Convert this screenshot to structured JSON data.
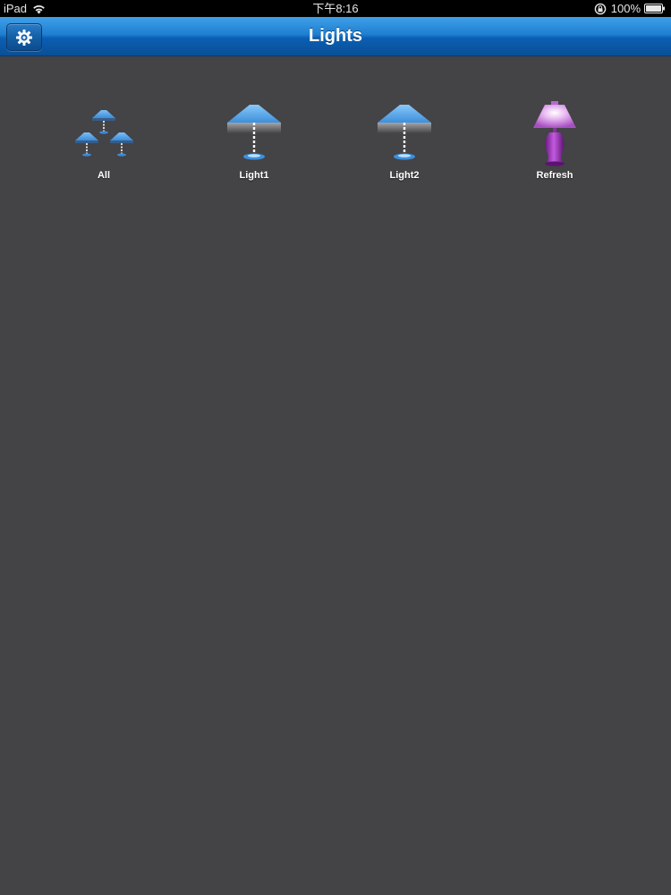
{
  "status_bar": {
    "device": "iPad",
    "time": "下午8:16",
    "battery": "100%",
    "icons": [
      "wifi-icon",
      "orientation-lock-icon",
      "battery-icon"
    ]
  },
  "nav_bar": {
    "title": "Lights",
    "settings_icon": "gear-icon",
    "accent_color": "#1f7fd1"
  },
  "tiles": [
    {
      "label": "All",
      "icon": "multi-lamp-icon",
      "color": "#4a9fe8"
    },
    {
      "label": "Light1",
      "icon": "blue-lamp-icon",
      "color": "#4a9fe8"
    },
    {
      "label": "Light2",
      "icon": "blue-lamp-icon",
      "color": "#4a9fe8"
    },
    {
      "label": "Refresh",
      "icon": "purple-lamp-icon",
      "color": "#9b3fb0"
    }
  ],
  "background_color": "#444346"
}
